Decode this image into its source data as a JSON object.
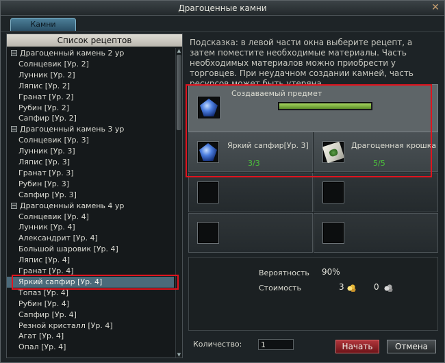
{
  "window": {
    "title": "Драгоценные камни",
    "close_glyph": "✕"
  },
  "tabs": [
    {
      "label": "Камни"
    }
  ],
  "recipes": {
    "header": "Список рецептов",
    "rows": [
      {
        "label": "Драгоценный камень 2 ур",
        "group": true
      },
      {
        "label": "Солнцевик [Ур. 2]"
      },
      {
        "label": "Лунник [Ур. 2]"
      },
      {
        "label": "Ляпис [Ур. 2]"
      },
      {
        "label": "Гранат [Ур. 2]"
      },
      {
        "label": "Рубин [Ур. 2]"
      },
      {
        "label": "Сапфир [Ур. 2]"
      },
      {
        "label": "Драгоценный камень 3 ур",
        "group": true
      },
      {
        "label": "Солнцевик [Ур. 3]"
      },
      {
        "label": "Лунник [Ур. 3]"
      },
      {
        "label": "Ляпис [Ур. 3]"
      },
      {
        "label": "Гранат [Ур. 3]"
      },
      {
        "label": "Рубин [Ур. 3]"
      },
      {
        "label": "Сапфир [Ур. 3]"
      },
      {
        "label": "Драгоценный камень 4 ур",
        "group": true
      },
      {
        "label": "Солнцевик [Ур. 4]"
      },
      {
        "label": "Лунник [Ур. 4]"
      },
      {
        "label": "Александрит [Ур. 4]"
      },
      {
        "label": "Большой шаровик [Ур. 4]"
      },
      {
        "label": "Ляпис [Ур. 4]"
      },
      {
        "label": "Гранат [Ур. 4]"
      },
      {
        "label": "Яркий сапфир [Ур. 4]",
        "selected": true
      },
      {
        "label": "Топаз [Ур. 4]"
      },
      {
        "label": "Рубин [Ур. 4]"
      },
      {
        "label": "Сапфир [Ур. 4]"
      },
      {
        "label": "Резной кристалл [Ур. 4]"
      },
      {
        "label": "Агат [Ур. 4]"
      },
      {
        "label": "Опал [Ур. 4]"
      }
    ]
  },
  "hint": "Подсказка: в левой части окна выберите рецепт, а затем поместите необходимые материалы. Часть необходимых материалов можно приобрести у торговцев. При неудачном создании камней, часть ресурсов может быть утеряна.",
  "craft": {
    "label": "Создаваемый предмет",
    "progress": 1.0
  },
  "materials": [
    {
      "name": "Яркий сапфир[Ур. 3]",
      "count": "3/3",
      "icon": "gem-icon"
    },
    {
      "name": "Драгоценная крошка",
      "count": "5/5",
      "icon": "scroll-icon"
    }
  ],
  "info": {
    "probability_label": "Вероятность",
    "probability_value": "90%",
    "cost_label": "Стоимость",
    "cost_gold": "3",
    "cost_silver": "0"
  },
  "quantity": {
    "label": "Количество:",
    "value": "1"
  },
  "buttons": {
    "start": "Начать",
    "cancel": "Отмена"
  },
  "colors": {
    "accent_red": "#e0141e",
    "count_green": "#4bc23a",
    "selected_row": "#4b6a7a"
  }
}
